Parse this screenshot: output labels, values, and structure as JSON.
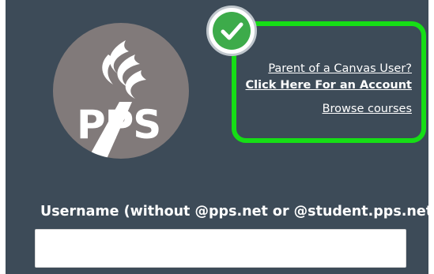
{
  "logo": {
    "text": "PPS",
    "circle_color": "#817a7a"
  },
  "links": {
    "parent_question": "Parent of a Canvas User?",
    "create_account": "Click Here For an Account",
    "browse_courses": "Browse courses"
  },
  "highlight": {
    "box_color": "#16de16",
    "badge_icon": "checkmark-icon",
    "badge_color": "#3dab4a"
  },
  "login": {
    "username_label": "Username (without @pps.net or @student.pps.net)",
    "username_value": "",
    "username_placeholder": ""
  }
}
